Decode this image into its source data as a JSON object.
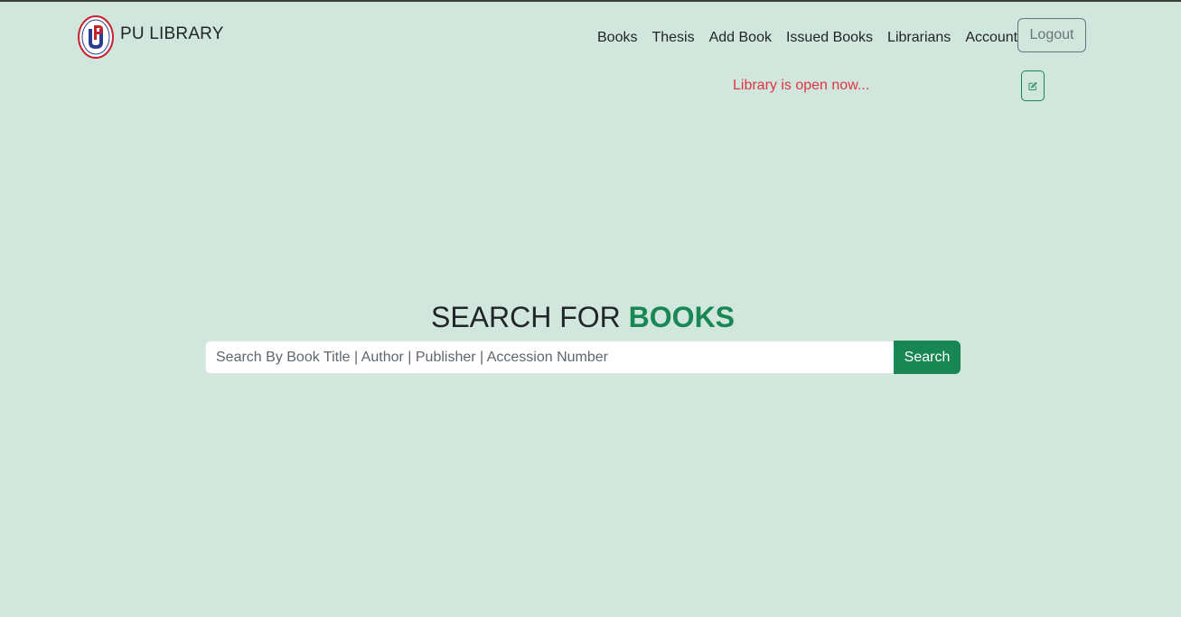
{
  "brand": {
    "name": "PU LIBRARY",
    "logo_icon": "university-logo-icon"
  },
  "nav": {
    "items": [
      {
        "label": "Books"
      },
      {
        "label": "Thesis"
      },
      {
        "label": "Add Book"
      },
      {
        "label": "Issued Books"
      },
      {
        "label": "Librarians"
      },
      {
        "label": "Account"
      }
    ],
    "logout_label": "Logout"
  },
  "status": {
    "text": "Library is open now...",
    "color": "#dc3545",
    "edit_icon": "edit-icon"
  },
  "hero": {
    "title_prefix": "SEARCH FOR",
    "title_accent": "BOOKS",
    "accent_color": "#198754"
  },
  "search": {
    "placeholder": "Search By Book Title | Author | Publisher | Accession Number",
    "value": "",
    "button_label": "Search"
  },
  "theme": {
    "background": "#d1e7dd",
    "primary": "#198754",
    "secondary": "#6c757d"
  }
}
